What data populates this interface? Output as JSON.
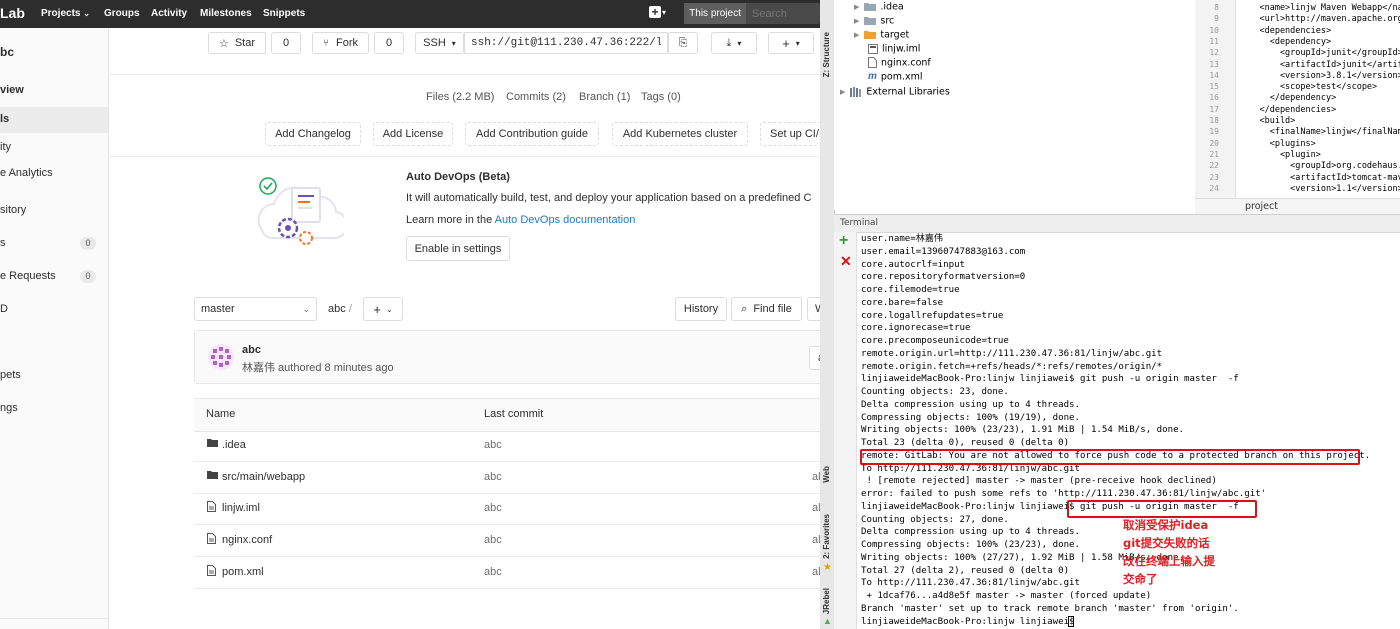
{
  "gitlab": {
    "brand": "Lab",
    "nav": [
      "Projects",
      "Groups",
      "Activity",
      "Milestones",
      "Snippets"
    ],
    "this_project": "This project",
    "search_placeholder": "Search",
    "sidebar": {
      "project_letter": "bc",
      "items": [
        {
          "label": "view",
          "badge": ""
        },
        {
          "label": "ls",
          "badge": ""
        },
        {
          "label": "ity",
          "badge": ""
        },
        {
          "label": "e Analytics",
          "badge": ""
        },
        {
          "label": "sitory",
          "badge": ""
        },
        {
          "label": "s",
          "badge": "0"
        },
        {
          "label": "e Requests",
          "badge": "0"
        },
        {
          "label": "D",
          "badge": ""
        },
        {
          "label": "pets",
          "badge": ""
        },
        {
          "label": "ngs",
          "badge": ""
        }
      ]
    },
    "actions": {
      "star_label": "Star",
      "star_count": "0",
      "fork_label": "Fork",
      "fork_count": "0",
      "clone_protocol": "SSH",
      "clone_url": "ssh://git@111.230.47.36:222/li"
    },
    "stats": [
      "Files (2.2 MB)",
      "Commits (2)",
      "Branch (1)",
      "Tags (0)"
    ],
    "quick_buttons": [
      "Add Changelog",
      "Add License",
      "Add Contribution guide",
      "Add Kubernetes cluster",
      "Set up CI/"
    ],
    "devops": {
      "title": "Auto DevOps (Beta)",
      "desc": "It will automatically build, test, and deploy your application based on a predefined C",
      "learn_prefix": "Learn more in the ",
      "learn_link": "Auto DevOps documentation",
      "enable_btn": "Enable in settings"
    },
    "branch": {
      "selected": "master",
      "path": "abc",
      "path_sep": "/",
      "history_btn": "History",
      "find_file_btn": "Find file",
      "more_btn": "W"
    },
    "last_commit": {
      "title": "abc",
      "author_line": "林嘉伟 authored 8 minutes ago",
      "side": "a"
    },
    "table": {
      "headers": [
        "Name",
        "Last commit"
      ],
      "rows": [
        {
          "name": ".idea",
          "type": "folder",
          "commit": "abc",
          "extra": ""
        },
        {
          "name": "src/main/webapp",
          "type": "folder",
          "commit": "abc",
          "extra": "al"
        },
        {
          "name": "linjw.iml",
          "type": "file",
          "commit": "abc",
          "extra": "al"
        },
        {
          "name": "nginx.conf",
          "type": "file",
          "commit": "abc",
          "extra": "al"
        },
        {
          "name": "pom.xml",
          "type": "file",
          "commit": "abc",
          "extra": "al"
        }
      ]
    }
  },
  "ide": {
    "strip_labels": {
      "structure": "Z: Structure",
      "web": "Web",
      "favorites": "2: Favorites",
      "jrebel": "JRebel"
    },
    "project_tree": [
      {
        "name": ".idea",
        "kind": "folder",
        "indent": 0
      },
      {
        "name": "src",
        "kind": "folder",
        "indent": 0
      },
      {
        "name": "target",
        "kind": "folder-orange",
        "indent": 0
      },
      {
        "name": "linjw.iml",
        "kind": "iml",
        "indent": 1
      },
      {
        "name": "nginx.conf",
        "kind": "file",
        "indent": 1
      },
      {
        "name": "pom.xml",
        "kind": "maven",
        "indent": 1
      },
      {
        "name": "External Libraries",
        "kind": "lib",
        "indent": -1
      }
    ],
    "editor": {
      "lines": [
        {
          "n": "8",
          "code": "    <name>linjw Maven Webapp</na"
        },
        {
          "n": "9",
          "code": "    <url>http://maven.apache.org"
        },
        {
          "n": "10",
          "code": "    <dependencies>"
        },
        {
          "n": "11",
          "code": "      <dependency>"
        },
        {
          "n": "12",
          "code": "        <groupId>junit</groupId>"
        },
        {
          "n": "13",
          "code": "        <artifactId>junit</artif"
        },
        {
          "n": "14",
          "code": "        <version>3.8.1</version>"
        },
        {
          "n": "15",
          "code": "        <scope>test</scope>"
        },
        {
          "n": "16",
          "code": "      </dependency>"
        },
        {
          "n": "17",
          "code": "    </dependencies>"
        },
        {
          "n": "18",
          "code": "    <build>"
        },
        {
          "n": "19",
          "code": "      <finalName>linjw</finalName"
        },
        {
          "n": "20",
          "code": "      <plugins>"
        },
        {
          "n": "21",
          "code": "        <plugin>"
        },
        {
          "n": "22",
          "code": "          <groupId>org.codehaus."
        },
        {
          "n": "23",
          "code": "          <artifactId>tomcat-mav"
        },
        {
          "n": "24",
          "code": "          <version>1.1</version>"
        }
      ],
      "breadcrumb": "project"
    },
    "terminal": {
      "title": "Terminal",
      "lines": [
        "user.name=林嘉伟",
        "user.email=13960747883@163.com",
        "core.autocrlf=input",
        "core.repositoryformatversion=0",
        "core.filemode=true",
        "core.bare=false",
        "core.logallrefupdates=true",
        "core.ignorecase=true",
        "core.precomposeunicode=true",
        "remote.origin.url=http://111.230.47.36:81/linjw/abc.git",
        "remote.origin.fetch=+refs/heads/*:refs/remotes/origin/*",
        "linjiaweideMacBook-Pro:linjw linjiawei$ git push -u origin master  -f",
        "Counting objects: 23, done.",
        "Delta compression using up to 4 threads.",
        "Compressing objects: 100% (19/19), done.",
        "Writing objects: 100% (23/23), 1.91 MiB | 1.54 MiB/s, done.",
        "Total 23 (delta 0), reused 0 (delta 0)",
        "remote: GitLab: You are not allowed to force push code to a protected branch on this project.",
        "To http://111.230.47.36:81/linjw/abc.git",
        " ! [remote rejected] master -> master (pre-receive hook declined)",
        "error: failed to push some refs to 'http://111.230.47.36:81/linjw/abc.git'",
        "linjiaweideMacBook-Pro:linjw linjiawei$ git push -u origin master  -f",
        "Counting objects: 27, done.",
        "Delta compression using up to 4 threads.",
        "Compressing objects: 100% (23/23), done.",
        "Writing objects: 100% (27/27), 1.92 MiB | 1.58 MiB/s, done.",
        "Total 27 (delta 2), reused 0 (delta 0)",
        "To http://111.230.47.36:81/linjw/abc.git",
        " + 1dcaf76...a4d8e5f master -> master (forced update)",
        "Branch 'master' set up to track remote branch 'master' from 'origin'.",
        "linjiaweideMacBook-Pro:linjw linjiawei$ "
      ],
      "note_lines": [
        "取消受保护idea",
        "git提交失败的话",
        "改在终端上输入提",
        "交命了"
      ]
    },
    "colors": {
      "highlight_red": "#d9111a",
      "note_red": "#e51c23"
    }
  }
}
